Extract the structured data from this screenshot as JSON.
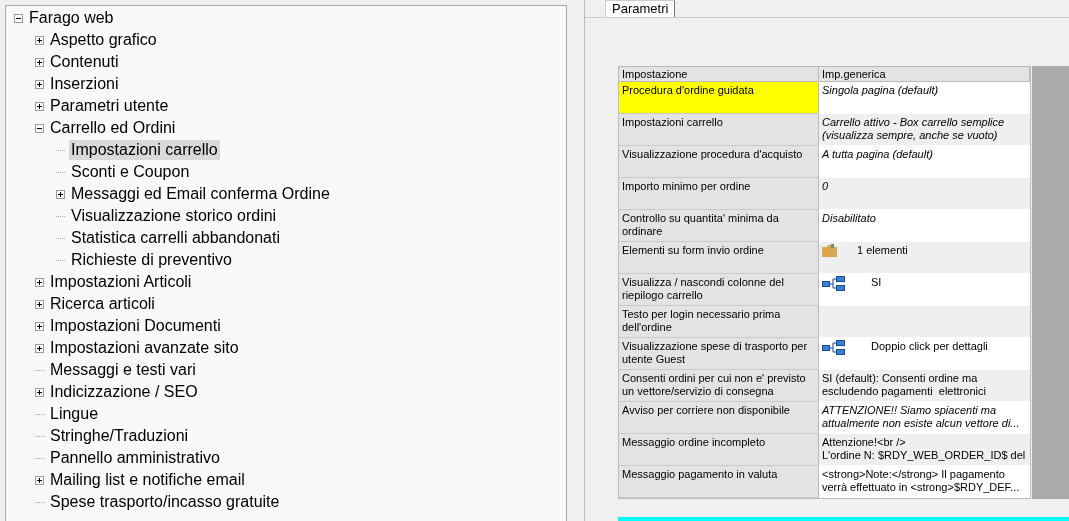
{
  "tree": {
    "label": "Farago web",
    "kind": "folder",
    "expanded": true,
    "selected": false,
    "children": [
      {
        "label": "Aspetto grafico",
        "kind": "folder",
        "expanded": false,
        "selected": false
      },
      {
        "label": "Contenuti",
        "kind": "folder",
        "expanded": false,
        "selected": false
      },
      {
        "label": "Inserzioni",
        "kind": "folder",
        "expanded": false,
        "selected": false
      },
      {
        "label": "Parametri utente",
        "kind": "folder",
        "expanded": false,
        "selected": false
      },
      {
        "label": "Carrello ed Ordini",
        "kind": "folder",
        "expanded": true,
        "selected": false,
        "children": [
          {
            "label": "Impostazioni carrello",
            "kind": "leaf",
            "selected": true
          },
          {
            "label": "Sconti e Coupon",
            "kind": "leaf",
            "selected": false
          },
          {
            "label": "Messaggi ed Email conferma Ordine",
            "kind": "folder",
            "expanded": false,
            "selected": false
          },
          {
            "label": "Visualizzazione storico ordini",
            "kind": "leaf",
            "selected": false
          },
          {
            "label": "Statistica carrelli abbandonati",
            "kind": "leaf",
            "selected": false
          },
          {
            "label": "Richieste di preventivo",
            "kind": "leaf",
            "selected": false
          }
        ]
      },
      {
        "label": "Impostazioni Articoli",
        "kind": "folder",
        "expanded": false,
        "selected": false
      },
      {
        "label": "Ricerca articoli",
        "kind": "folder",
        "expanded": false,
        "selected": false
      },
      {
        "label": "Impostazioni Documenti",
        "kind": "folder",
        "expanded": false,
        "selected": false
      },
      {
        "label": "Impostazioni avanzate sito",
        "kind": "folder",
        "expanded": false,
        "selected": false
      },
      {
        "label": "Messaggi e testi vari",
        "kind": "leaf",
        "selected": false
      },
      {
        "label": "Indicizzazione / SEO",
        "kind": "folder",
        "expanded": false,
        "selected": false
      },
      {
        "label": "Lingue",
        "kind": "leaf",
        "selected": false
      },
      {
        "label": "Stringhe/Traduzioni",
        "kind": "leaf",
        "selected": false
      },
      {
        "label": "Pannello amministrativo",
        "kind": "leaf",
        "selected": false
      },
      {
        "label": "Mailing list e notifiche email",
        "kind": "folder",
        "expanded": false,
        "selected": false
      },
      {
        "label": "Spese trasporto/incasso gratuite",
        "kind": "leaf",
        "selected": false
      }
    ]
  },
  "tabs": [
    {
      "label": "Parametri",
      "selected": true
    }
  ],
  "table": {
    "columns": [
      "Impostazione",
      "Imp.generica"
    ],
    "rows": [
      {
        "name": "Procedura d'ordine guidata",
        "selected": true,
        "kind": "italic",
        "value": "Singola pagina (default)"
      },
      {
        "name": "Impostazioni carrello",
        "selected": false,
        "kind": "italic",
        "value": "Carrello attivo - Box carrello semplice (visualizza sempre, anche se vuoto)"
      },
      {
        "name": "Visualizzazione procedura d'acquisto",
        "selected": false,
        "kind": "italic",
        "value": "A tutta pagina (default)"
      },
      {
        "name": "Importo minimo per ordine",
        "selected": false,
        "kind": "italic",
        "value": "0"
      },
      {
        "name": "Controllo su quantita' minima da ordinare",
        "selected": false,
        "kind": "italic",
        "value": "Disabilitato"
      },
      {
        "name": "Elementi su form invio ordine",
        "selected": false,
        "kind": "folder",
        "value": "1 elementi"
      },
      {
        "name": "Visualizza / nascondi colonne del riepilogo carrello",
        "selected": false,
        "kind": "tree",
        "value": "SI"
      },
      {
        "name": "Testo per login necessario prima dell'ordine",
        "selected": false,
        "kind": "empty"
      },
      {
        "name": "Visualizzazione spese di trasporto per utente Guest",
        "selected": false,
        "kind": "tree",
        "value": "Doppio click per dettagli"
      },
      {
        "name": "Consenti ordini per cui non e' previsto un vettore/servizio di consegna",
        "selected": false,
        "kind": "plain",
        "value": "SI (default): Consenti ordine ma escludendo pagamenti  elettronici"
      },
      {
        "name": "Avviso per corriere non disponibile",
        "selected": false,
        "kind": "italic",
        "value": "ATTENZIONE!! Siamo spiacenti ma attualmente non esiste alcun vettore di..."
      },
      {
        "name": "Messaggio ordine incompleto",
        "selected": false,
        "kind": "plain",
        "value": "Attenzione!<br />\nL'ordine N: $RDY_WEB_ORDER_ID$ del"
      },
      {
        "name": "Messaggio pagamento in valuta",
        "selected": false,
        "kind": "plain",
        "value": "<strong>Note:</strong> Il pagamento verrà effettuato in <strong>$RDY_DEF..."
      }
    ]
  }
}
